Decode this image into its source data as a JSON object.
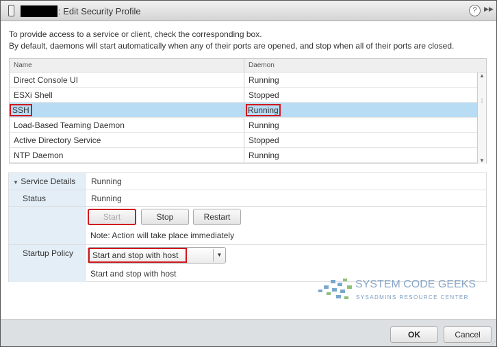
{
  "title": ": Edit Security Profile",
  "intro": [
    "To provide access to a service or client, check the corresponding box.",
    "By default, daemons will start automatically when any of their ports are opened, and stop when all of their ports are closed."
  ],
  "table": {
    "columns": [
      "Name",
      "Daemon"
    ],
    "rows": [
      {
        "name": "Direct Console UI",
        "daemon": "Running"
      },
      {
        "name": "ESXi Shell",
        "daemon": "Stopped"
      },
      {
        "name": "SSH",
        "daemon": "Running"
      },
      {
        "name": "Load-Based Teaming Daemon",
        "daemon": "Running"
      },
      {
        "name": "Active Directory Service",
        "daemon": "Stopped"
      },
      {
        "name": "NTP Daemon",
        "daemon": "Running"
      }
    ],
    "selected": "SSH"
  },
  "details": {
    "header_label": "Service Details",
    "header_value": "Running",
    "status_label": "Status",
    "status_value": "Running",
    "start": "Start",
    "stop": "Stop",
    "restart": "Restart",
    "note": "Note: Action will take place immediately",
    "policy_label": "Startup Policy",
    "policy_value": "Start and stop with host",
    "policy_desc": "Start and stop with host"
  },
  "logo": {
    "name": "SYSTEM CODE GEEKS",
    "tagline": "SYSADMINS RESOURCE CENTER"
  },
  "footer": {
    "ok": "OK",
    "cancel": "Cancel"
  },
  "colors": {
    "highlight": "#d0171d",
    "selected": "#b8dcf3"
  }
}
